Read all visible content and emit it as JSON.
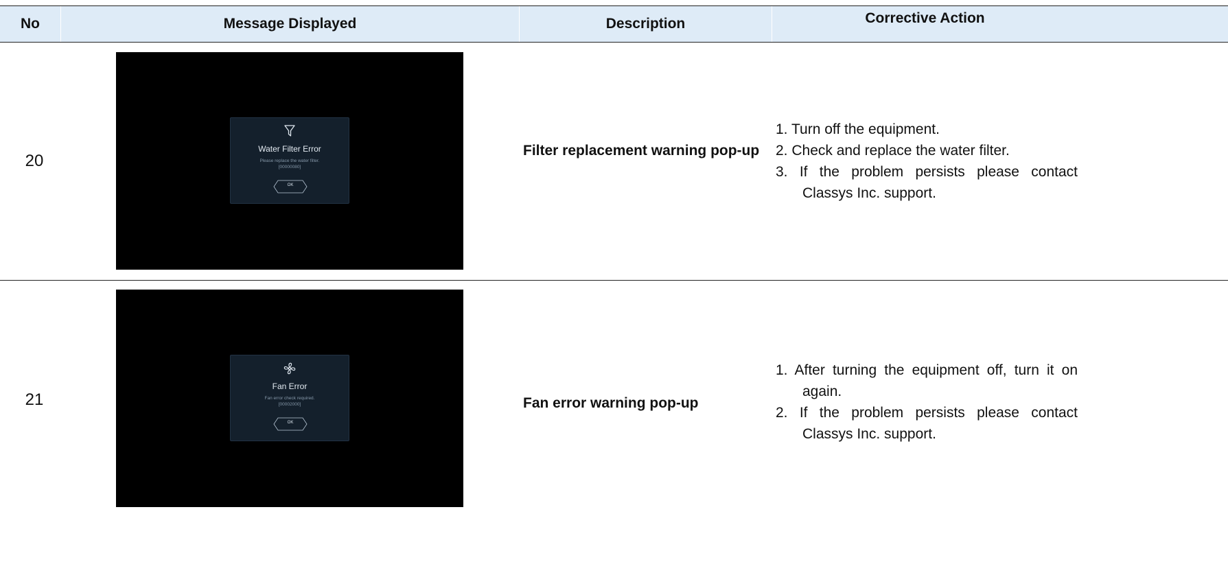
{
  "header": {
    "no": "No",
    "message": "Message Displayed",
    "description": "Description",
    "action": "Corrective Action"
  },
  "rows": [
    {
      "no": "20",
      "popup": {
        "icon": "filter-funnel-icon",
        "title": "Water Filter Error",
        "message": "Please replace the water filter.",
        "code": "[00000080]",
        "button": "OK"
      },
      "description": "Filter replacement warning pop-up",
      "actions": [
        "1. Turn off the equipment.",
        "2. Check and replace the water filter.",
        "3. If the problem persists please contact Classys Inc. support."
      ]
    },
    {
      "no": "21",
      "popup": {
        "icon": "fan-icon",
        "title": "Fan Error",
        "message": "Fan error check required.",
        "code": "[00002000]",
        "button": "OK"
      },
      "description": "Fan error warning pop-up",
      "actions": [
        "1. After turning the equipment off, turn it on again.",
        "2. If the problem persists please contact Classys Inc. support."
      ]
    }
  ],
  "colors": {
    "header_bg": "#deebf7",
    "popup_bg": "#14202c",
    "screen_bg": "#000000"
  }
}
